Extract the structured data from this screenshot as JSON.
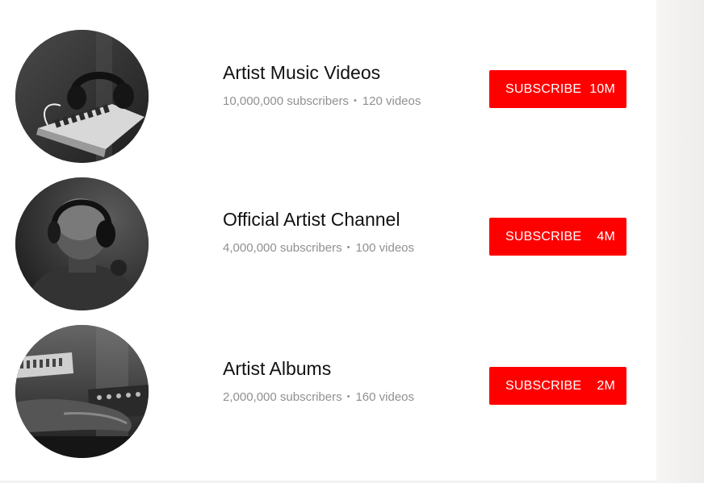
{
  "channels": [
    {
      "name": "Artist Music Videos",
      "subscribers": "10,000,000 subscribers",
      "separator": "•",
      "videos": "120 videos",
      "subscribe_label": "SUBSCRIBE",
      "subscribe_count": "10M"
    },
    {
      "name": "Official Artist Channel",
      "subscribers": "4,000,000 subscribers",
      "separator": "•",
      "videos": "100 videos",
      "subscribe_label": "SUBSCRIBE",
      "subscribe_count": "4M"
    },
    {
      "name": "Artist Albums",
      "subscribers": "2,000,000 subscribers",
      "separator": "•",
      "videos": "160 videos",
      "subscribe_label": "SUBSCRIBE",
      "subscribe_count": "2M"
    }
  ],
  "colors": {
    "subscribe_button": "#ff0000",
    "title_text": "#111111",
    "meta_text": "#909090",
    "background": "#ffffff"
  },
  "icons": {
    "avatar_1": "headphones-synth-photo",
    "avatar_2": "person-with-headphones-photo",
    "avatar_3": "hands-on-keyboard-photo"
  }
}
